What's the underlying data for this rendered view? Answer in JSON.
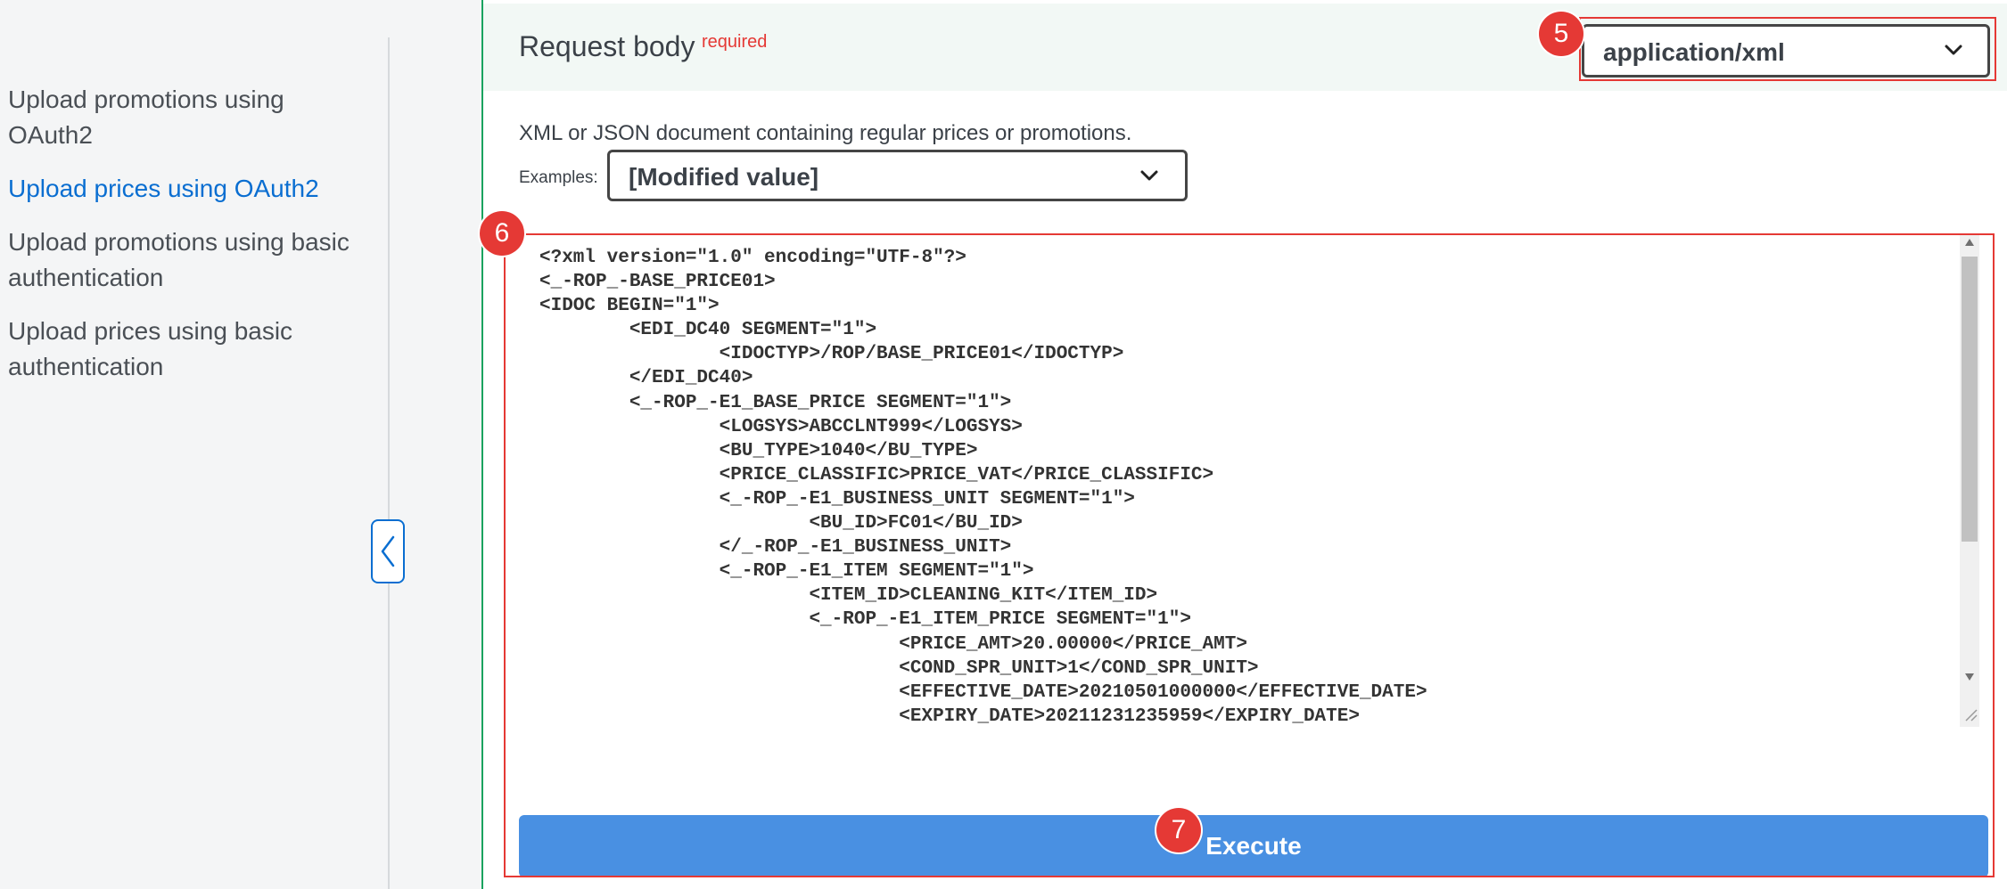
{
  "sidebar": {
    "items": [
      {
        "label_line1": "Upload promotions using",
        "label_line2": "OAuth2"
      },
      {
        "label_line1": "Upload prices using OAuth2",
        "label_line2": ""
      },
      {
        "label_line1": "Upload promotions using basic",
        "label_line2": "authentication"
      },
      {
        "label_line1": "Upload prices using basic",
        "label_line2": "authentication"
      }
    ],
    "active_index": 1
  },
  "request_body": {
    "title": "Request body",
    "required_label": "required",
    "content_type": "application/xml",
    "description": "XML or JSON document containing regular prices or promotions.",
    "examples_label": "Examples:",
    "examples_value": "[Modified value]",
    "code_lines": [
      "<?xml version=\"1.0\" encoding=\"UTF-8\"?>",
      "<_-ROP_-BASE_PRICE01>",
      "<IDOC BEGIN=\"1\">",
      "        <EDI_DC40 SEGMENT=\"1\">",
      "                <IDOCTYP>/ROP/BASE_PRICE01</IDOCTYP>",
      "        </EDI_DC40>",
      "        <_-ROP_-E1_BASE_PRICE SEGMENT=\"1\">",
      "                <LOGSYS>ABCCLNT999</LOGSYS>",
      "                <BU_TYPE>1040</BU_TYPE>",
      "                <PRICE_CLASSIFIC>PRICE_VAT</PRICE_CLASSIFIC>",
      "                <_-ROP_-E1_BUSINESS_UNIT SEGMENT=\"1\">",
      "                        <BU_ID>FC01</BU_ID>",
      "                </_-ROP_-E1_BUSINESS_UNIT>",
      "                <_-ROP_-E1_ITEM SEGMENT=\"1\">",
      "                        <ITEM_ID>CLEANING_KIT</ITEM_ID>",
      "                        <_-ROP_-E1_ITEM_PRICE SEGMENT=\"1\">",
      "                                <PRICE_AMT>20.00000</PRICE_AMT>",
      "                                <COND_SPR_UNIT>1</COND_SPR_UNIT>",
      "                                <EFFECTIVE_DATE>20210501000000</EFFECTIVE_DATE>",
      "                                <EXPIRY_DATE>20211231235959</EXPIRY_DATE>"
    ]
  },
  "execute_label": "Execute",
  "annotations": {
    "badge5": "5",
    "badge6": "6",
    "badge7": "7"
  },
  "colors": {
    "accent": "#0a6ed1",
    "execute": "#4990e2",
    "annotation": "#e53935",
    "header_bg": "#f2f8f5"
  }
}
